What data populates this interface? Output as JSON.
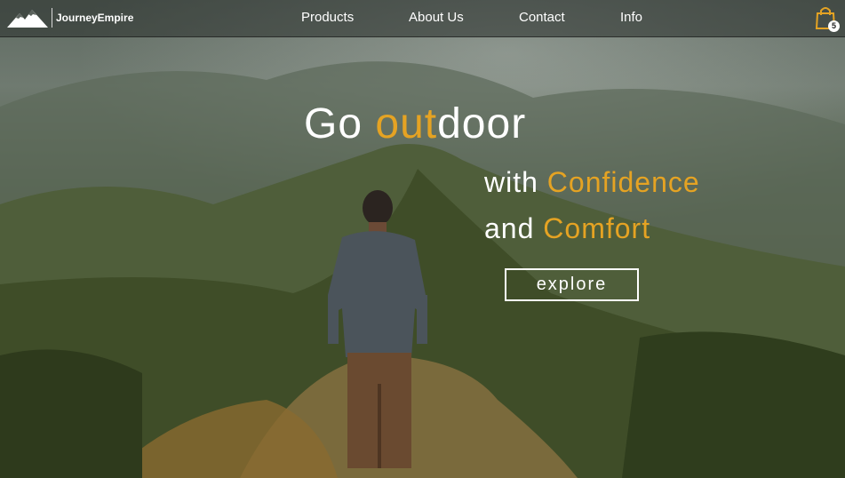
{
  "brand": {
    "name": "JourneyEmpire",
    "logo_icon": "mountain-logo-icon"
  },
  "nav": {
    "items": [
      "Products",
      "About Us",
      "Contact",
      "Info"
    ]
  },
  "cart": {
    "icon": "shopping-bag-icon",
    "count": "5",
    "color": "#e5a323"
  },
  "hero": {
    "line1_prefix": "Go ",
    "line1_accent": "out",
    "line1_suffix": "door",
    "line2_prefix": "with ",
    "line2_accent": "Confidence",
    "line3_prefix": "and ",
    "line3_accent": "Comfort",
    "cta_label": "explore"
  },
  "colors": {
    "accent": "#e5a323",
    "text": "#ffffff"
  }
}
